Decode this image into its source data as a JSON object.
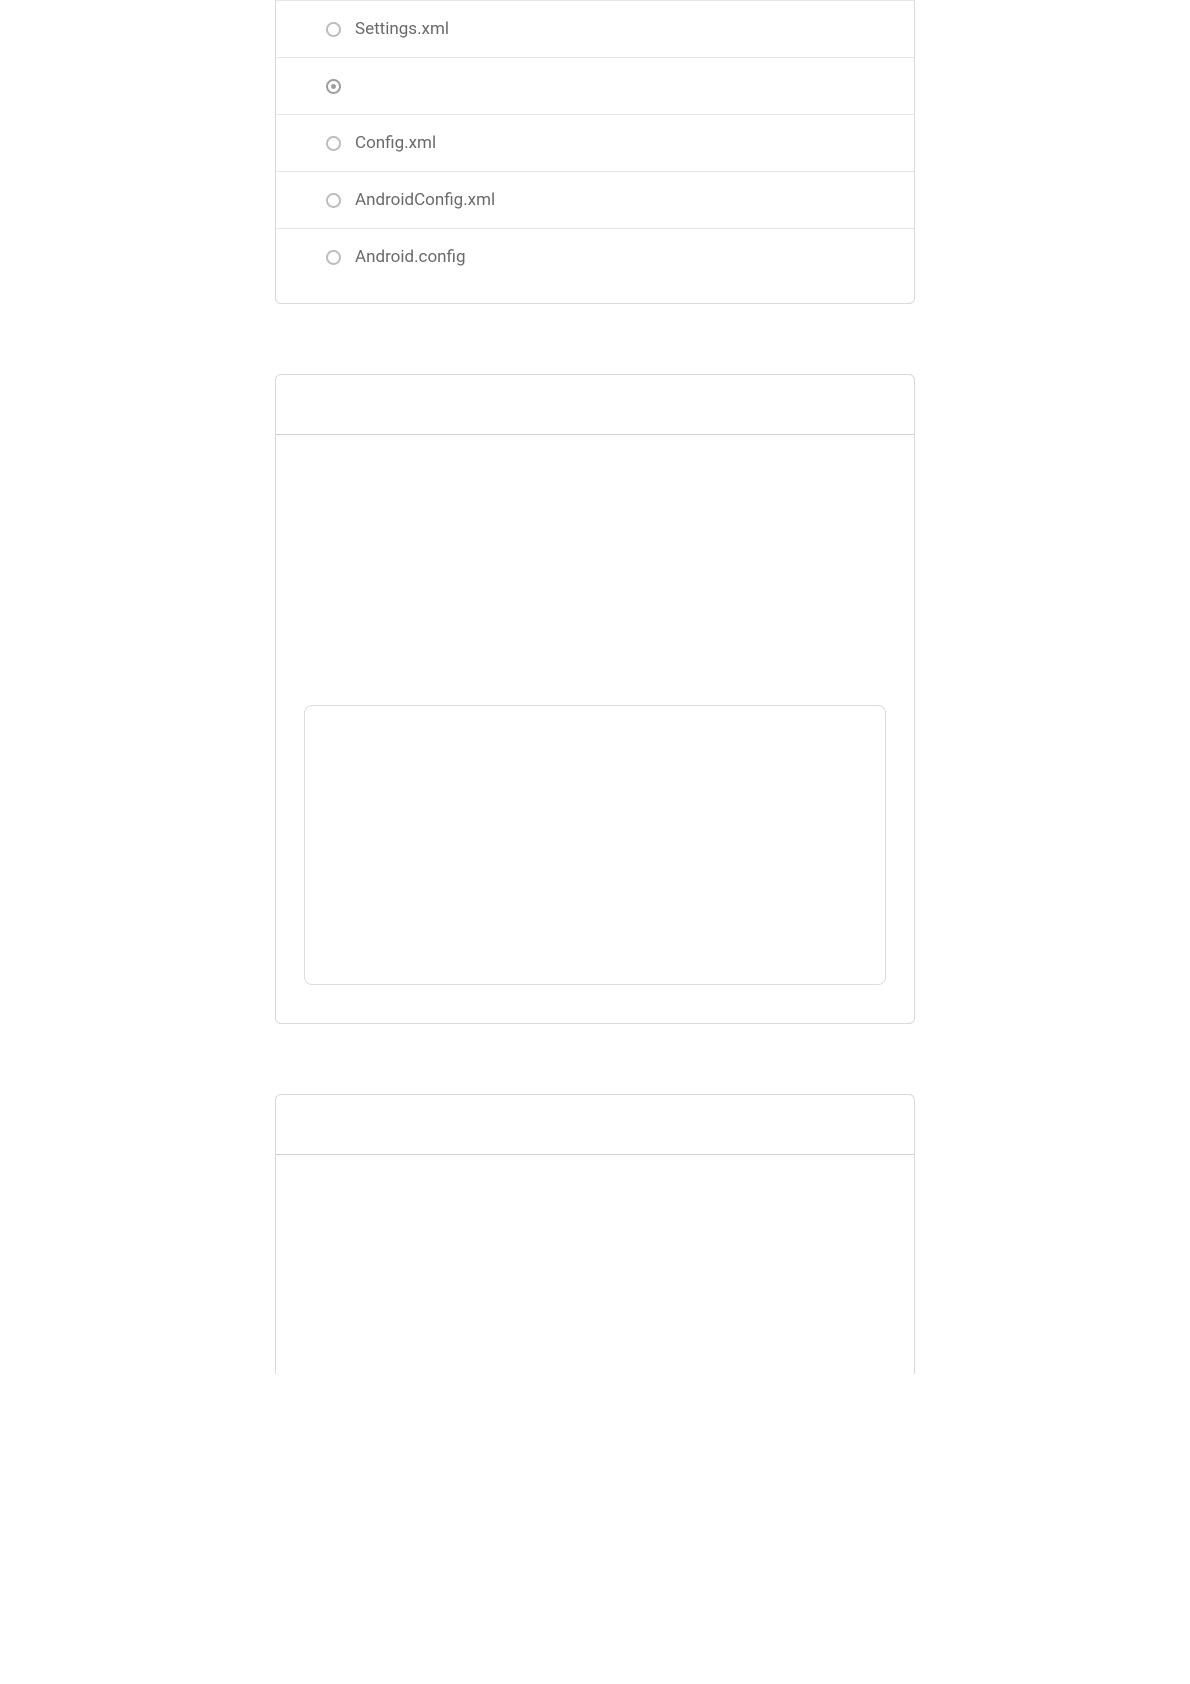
{
  "card1": {
    "options": [
      {
        "label": "Settings.xml",
        "selected": false
      },
      {
        "label": "",
        "selected": true
      },
      {
        "label": "Config.xml",
        "selected": false
      },
      {
        "label": "AndroidConfig.xml",
        "selected": false
      },
      {
        "label": "Android.config",
        "selected": false
      }
    ]
  }
}
